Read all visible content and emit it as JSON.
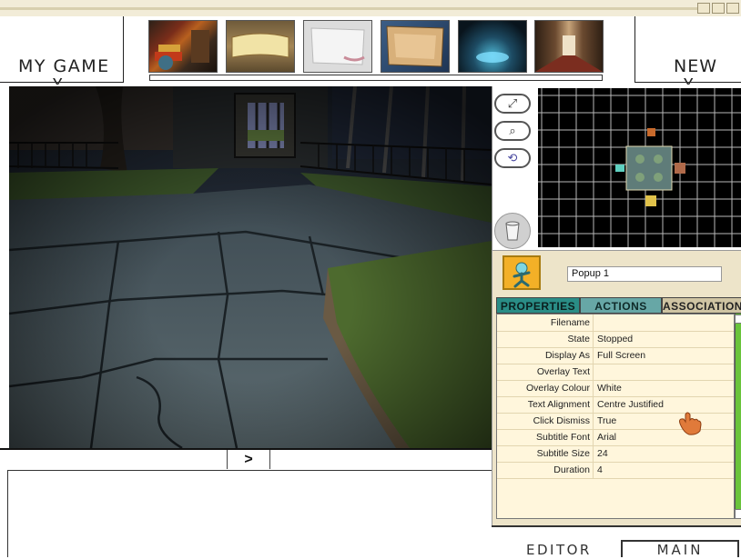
{
  "header": {
    "game_menu_label": "MY GAME",
    "new_menu_label": "NEW",
    "thumbnails": [
      {
        "name": "library-room-thumbnail"
      },
      {
        "name": "parchment-banner-thumbnail"
      },
      {
        "name": "white-scroll-thumbnail"
      },
      {
        "name": "old-map-thumbnail"
      },
      {
        "name": "portal-room-thumbnail"
      },
      {
        "name": "corridor-thumbnail"
      }
    ]
  },
  "viewport": {
    "play_button_label": ">"
  },
  "tools": [
    {
      "name": "resize-icon",
      "glyph": "⤢"
    },
    {
      "name": "magnify-icon",
      "glyph": "🔍"
    },
    {
      "name": "rotate-icon",
      "glyph": "⟲"
    },
    {
      "name": "trash-icon",
      "glyph": ""
    }
  ],
  "object": {
    "name": "Popup 1",
    "icon": "popup-figure-icon"
  },
  "tabs": {
    "properties": "PROPERTIES",
    "actions": "ACTIONS",
    "associations": "ASSOCIATIONS",
    "active": "properties"
  },
  "properties": [
    {
      "name": "Filename",
      "value": ""
    },
    {
      "name": "State",
      "value": "Stopped"
    },
    {
      "name": "Display As",
      "value": "Full Screen"
    },
    {
      "name": "Overlay Text",
      "value": ""
    },
    {
      "name": "Overlay Colour",
      "value": "White"
    },
    {
      "name": "Text Alignment",
      "value": "Centre Justified"
    },
    {
      "name": "Click Dismiss",
      "value": "True"
    },
    {
      "name": "Subtitle Font",
      "value": "Arial"
    },
    {
      "name": "Subtitle Size",
      "value": "24"
    },
    {
      "name": "Duration",
      "value": "4"
    }
  ],
  "footer": {
    "editor_label": "EDITOR",
    "main_label": "MAIN"
  },
  "colors": {
    "tab_active": "#2a8d86",
    "tab_inactive": "#67a7a6",
    "panel_bg": "#ede4c9",
    "scrollbar": "#6ac43c"
  }
}
